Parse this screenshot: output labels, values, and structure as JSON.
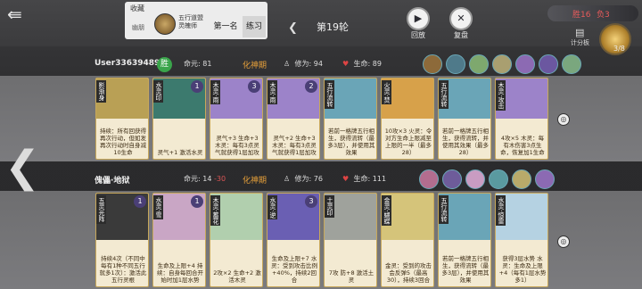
{
  "header": {
    "back_icon": "back-arrow-icon",
    "collection": {
      "label": "收藏",
      "category": "幽朋",
      "title": "五行道盟灵魄师"
    },
    "tabs": [
      {
        "label": "第一名"
      },
      {
        "label": "练习"
      }
    ],
    "round_label": "第19轮",
    "replay_label": "回放",
    "review_label": "复盘",
    "stats": {
      "wins": "胜16",
      "losses": "负3"
    },
    "scoreboard_label": "计分板",
    "ring_count": "3/8"
  },
  "players": [
    {
      "name": "User336394898",
      "badge": "胜",
      "life_label": "命元:",
      "life_value": "81",
      "realm": "化神期",
      "cultivation_label": "修为:",
      "cultivation_value": "94",
      "hp_label": "生命:",
      "hp_value": "89",
      "cards": [
        {
          "name": "影渐身",
          "cost": "",
          "text": "持续：所有回获得再次行动，但如发再次行动时自身减10生命",
          "art_color": "#b9a055"
        },
        {
          "name": "水灵印",
          "cost": "1",
          "text": "灵气+1 激活水灵",
          "art_color": "#3c7a6e"
        },
        {
          "name": "木灵·雨",
          "cost": "3",
          "text": "灵气+3 生命+3 木灵：每有3点灵气就获得1层加攻",
          "art_color": "#9c83c9"
        },
        {
          "name": "木灵·雨",
          "cost": "2",
          "text": "灵气+2 生命+3 木灵：每有3点灵气就获得1层加攻",
          "art_color": "#9c83c9"
        },
        {
          "name": "五行流转",
          "cost": "",
          "text": "若前一格牌五行相生，获得流转（最多3层），并使用其效果",
          "art_color": "#6aa5b7"
        },
        {
          "name": "火灵·焚",
          "cost": "",
          "text": "10攻×3 火灵：令对方生命上限减至上限的一半（最多28）",
          "art_color": "#d7a14a"
        },
        {
          "name": "五行流转",
          "cost": "",
          "text": "若前一格牌五行相生，获得流转，并使用其效果（最多28）",
          "art_color": "#6aa5b7"
        },
        {
          "name": "木灵·攻击",
          "cost": "",
          "text": "4攻×5 木灵：每有木伤害3点生命，恢复加1生命",
          "art_color": "#9c83c9"
        }
      ]
    },
    {
      "name": "傀儡·地狱",
      "badge": "",
      "life_label": "命元:",
      "life_value": "14",
      "life_delta": "-30",
      "realm": "化神期",
      "cultivation_label": "修为:",
      "cultivation_value": "76",
      "hp_label": "生命:",
      "hp_value": "111",
      "cards": [
        {
          "name": "五灵光阵",
          "cost": "1",
          "text": "持续4次（不同中每有1种不同五行就多1次）：激活此五行灵根",
          "art_color": "#3a3a3a"
        },
        {
          "name": "水灵·雪",
          "cost": "1",
          "text": "生命及上限+4 持续：自身每回合开始时加1层水势",
          "art_color": "#c9a6c5"
        },
        {
          "name": "木灵·蓄花",
          "cost": "",
          "text": "2攻×2 生命+2 激活木灵",
          "art_color": "#b1cfae"
        },
        {
          "name": "水灵·逆",
          "cost": "3",
          "text": "生命及上限+7 水灵：受到攻击比例+40%，持续2回合",
          "art_color": "#6a5fb3"
        },
        {
          "name": "土灵印",
          "cost": "",
          "text": "7攻 防+8 激活土灵",
          "art_color": "#9fa29c"
        },
        {
          "name": "金灵·蝴蝶",
          "cost": "",
          "text": "金灵：受到的攻击会反弹5（最高30），持续3回合",
          "art_color": "#d5c47a"
        },
        {
          "name": "五行流转",
          "cost": "",
          "text": "若前一格牌五行相生，获得流转（最多3层），并使用其效果",
          "art_color": "#6aa5b7"
        },
        {
          "name": "水灵·惊雷",
          "cost": "",
          "text": "获得3层水势 水灵：生命及上限+4（每有1层水势多1）",
          "art_color": "#b5d2e2"
        }
      ]
    }
  ],
  "icons": {
    "nav_left": "chevron-left-icon",
    "cultivation": "person-icon",
    "hp": "heart-icon"
  }
}
